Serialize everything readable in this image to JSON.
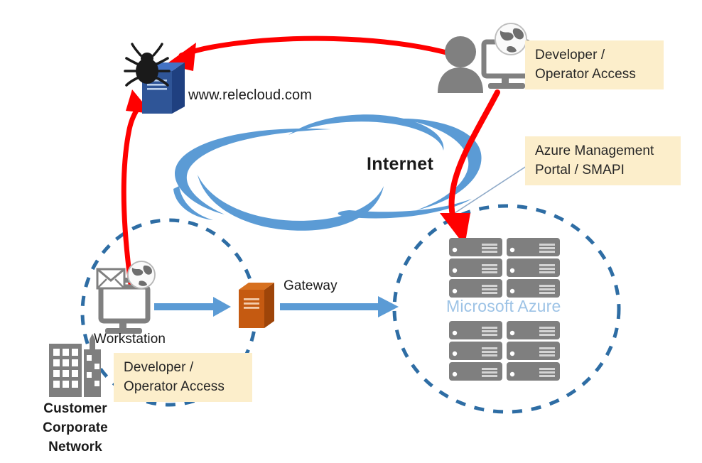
{
  "diagram": {
    "title": "Customer Corporate Network to Microsoft Azure access diagram",
    "colors": {
      "cloud_blue": "#5B9BD5",
      "dashed_circle": "#2E6DA4",
      "red_arrow": "#FF0000",
      "blue_arrow": "#5B9BD5",
      "gateway_orange": "#C55A11",
      "server_blue": "#2F5597",
      "rack_gray": "#7F7F7F",
      "person_gray": "#808080",
      "callout_bg": "#FCEECB",
      "azure_text": "#9DC3E6",
      "text_dark": "#1A1A1A"
    }
  },
  "nodes": {
    "relecloud": {
      "label": "www.relecloud.com",
      "icon": "blue-server-with-bug-icon"
    },
    "internet": {
      "label": "Internet",
      "icon": "cloud-swoosh-icon"
    },
    "workstation": {
      "label": "Workstation",
      "icon": "monitor-with-envelope-and-globe-icon"
    },
    "gateway": {
      "label": "Gateway",
      "icon": "orange-server-icon"
    },
    "azure": {
      "label": "Microsoft Azure",
      "icon": "server-rack-icon",
      "rack_groups": 2,
      "racks_per_group": 6
    },
    "corporate_network": {
      "label": "Customer\nCorporate\nNetwork",
      "icon": "office-buildings-icon"
    },
    "developer": {
      "icon": "person-with-monitor-and-globe-icon"
    }
  },
  "callouts": [
    {
      "id": "developer-operator-access-top",
      "text": "Developer /\nOperator Access"
    },
    {
      "id": "azure-management-portal",
      "text": "Azure Management\nPortal / SMAPI"
    },
    {
      "id": "developer-operator-access-bottom",
      "text": "Developer /\nOperator Access"
    }
  ],
  "connections": [
    {
      "id": "developer-to-relecloud",
      "from": "developer",
      "to": "relecloud",
      "color": "#FF0000",
      "style": "curved-arrow"
    },
    {
      "id": "developer-to-azure",
      "from": "developer",
      "to": "azure",
      "color": "#FF0000",
      "style": "curved-arrow"
    },
    {
      "id": "workstation-to-relecloud",
      "from": "workstation",
      "to": "relecloud",
      "color": "#FF0000",
      "style": "curved-arrow"
    },
    {
      "id": "workstation-to-gateway",
      "from": "workstation",
      "to": "gateway",
      "color": "#5B9BD5",
      "style": "straight-arrow"
    },
    {
      "id": "gateway-to-azure",
      "from": "gateway",
      "to": "azure",
      "color": "#5B9BD5",
      "style": "straight-arrow"
    }
  ],
  "boundaries": [
    {
      "id": "corporate-network-boundary",
      "style": "dashed-circle"
    },
    {
      "id": "azure-boundary",
      "style": "dashed-circle"
    }
  ]
}
